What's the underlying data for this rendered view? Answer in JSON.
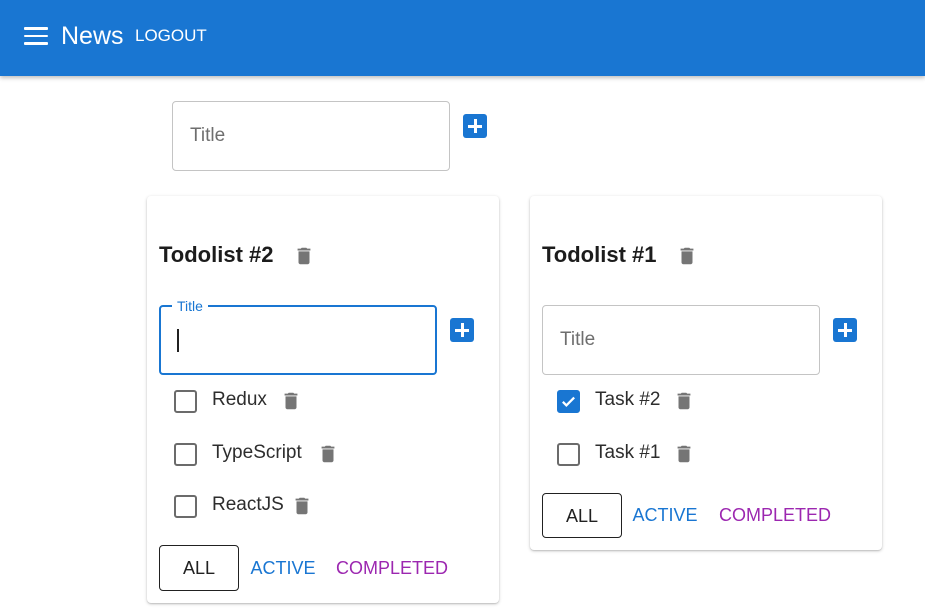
{
  "appbar": {
    "title": "News",
    "logout_label": "LOGOUT"
  },
  "add_list": {
    "placeholder": "Title"
  },
  "todolists": [
    {
      "title": "Todolist #2",
      "input_label": "Title",
      "tasks": [
        {
          "label": "Redux",
          "done": false
        },
        {
          "label": "TypeScript",
          "done": false
        },
        {
          "label": "ReactJS",
          "done": false
        }
      ],
      "filters": {
        "all": "ALL",
        "active": "ACTIVE",
        "completed": "COMPLETED"
      }
    },
    {
      "title": "Todolist #1",
      "input_placeholder": "Title",
      "tasks": [
        {
          "label": "Task #2",
          "done": true
        },
        {
          "label": "Task #1",
          "done": false
        }
      ],
      "filters": {
        "all": "ALL",
        "active": "ACTIVE",
        "completed": "COMPLETED"
      }
    }
  ],
  "colors": {
    "primary": "#1976d2",
    "secondary": "#9c27b0",
    "icon_grey": "#757575"
  }
}
